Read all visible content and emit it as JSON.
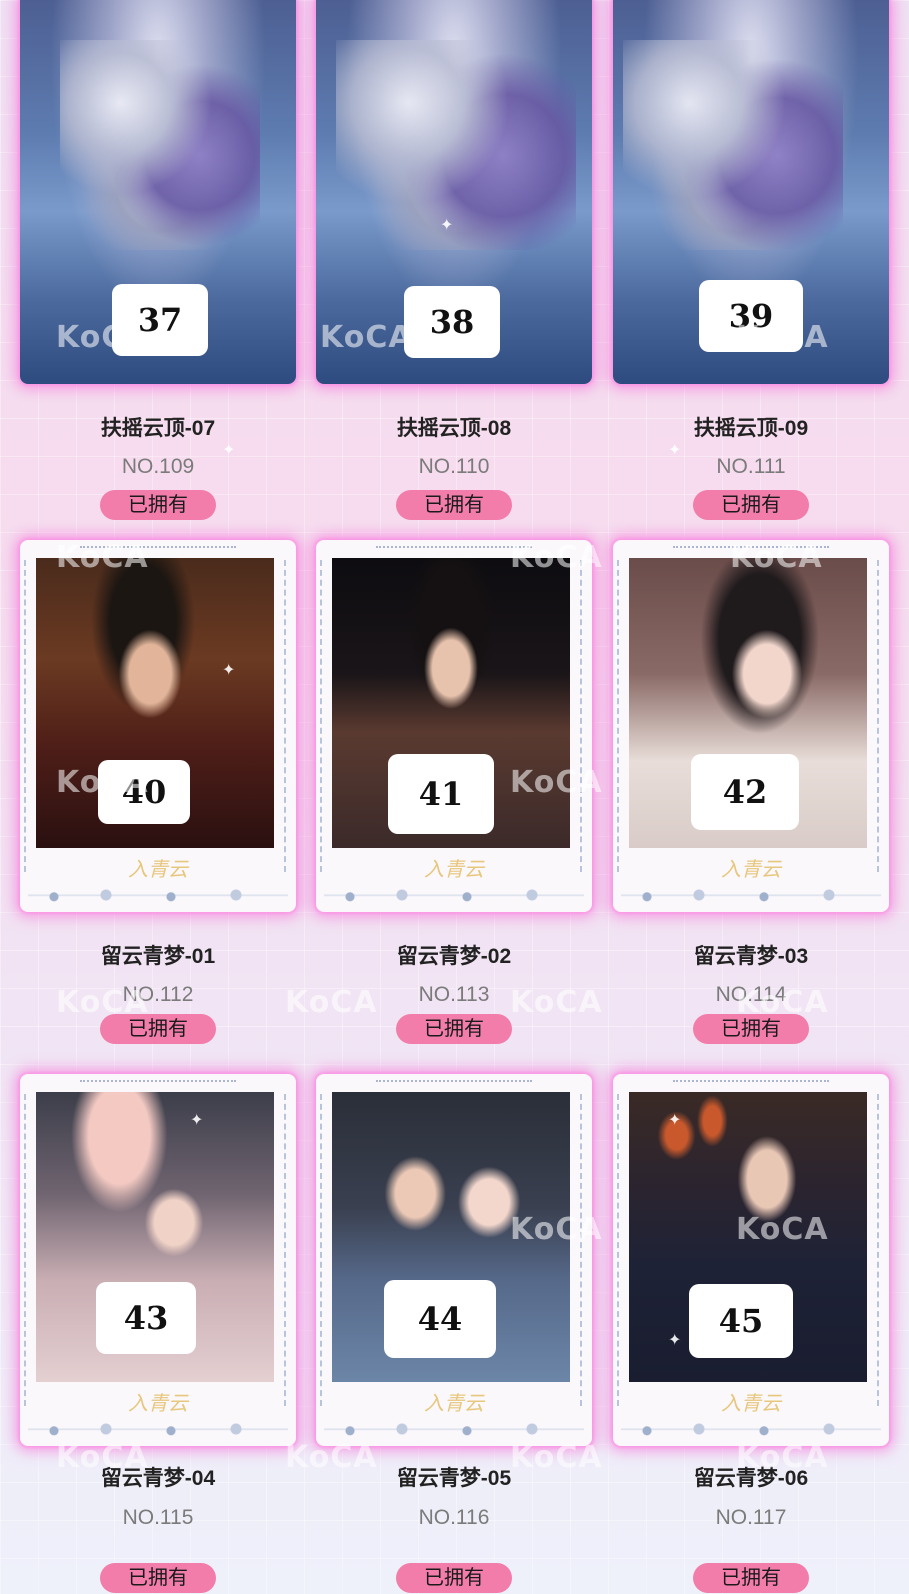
{
  "owned_label": "已拥有",
  "watermark": "KoCA",
  "frame_logo": "入青云",
  "cards": [
    {
      "number": "37",
      "title": "扶摇云顶-07",
      "no": "NO.109"
    },
    {
      "number": "38",
      "title": "扶摇云顶-08",
      "no": "NO.110"
    },
    {
      "number": "39",
      "title": "扶摇云顶-09",
      "no": "NO.111"
    },
    {
      "number": "40",
      "title": "留云青梦-01",
      "no": "NO.112"
    },
    {
      "number": "41",
      "title": "留云青梦-02",
      "no": "NO.113"
    },
    {
      "number": "42",
      "title": "留云青梦-03",
      "no": "NO.114"
    },
    {
      "number": "43",
      "title": "留云青梦-04",
      "no": "NO.115"
    },
    {
      "number": "44",
      "title": "留云青梦-05",
      "no": "NO.116"
    },
    {
      "number": "45",
      "title": "留云青梦-06",
      "no": "NO.117"
    }
  ],
  "colors": {
    "owned_badge": "#f27dab",
    "card_glow": "#f682dc",
    "background_top": "#efe2f4",
    "background_bottom": "#eef0fa"
  }
}
